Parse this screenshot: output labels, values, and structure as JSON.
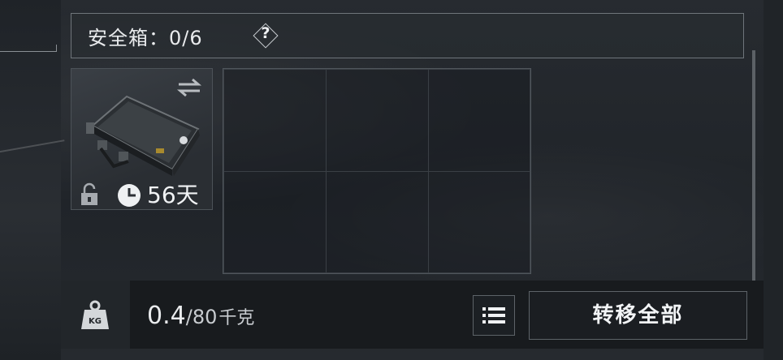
{
  "safe_box": {
    "label": "安全箱：",
    "used": "0",
    "capacity": "6",
    "help_symbol": "?"
  },
  "item": {
    "name_icon": "safe-case-icon",
    "timer": "56天",
    "locked": true
  },
  "grid": {
    "rows": 2,
    "cols": 3
  },
  "footer": {
    "weight_current": "0.4",
    "weight_separator": "/",
    "weight_max": "80",
    "weight_unit": "千克",
    "kg_icon_label": "KG",
    "transfer_all_label": "转移全部"
  }
}
